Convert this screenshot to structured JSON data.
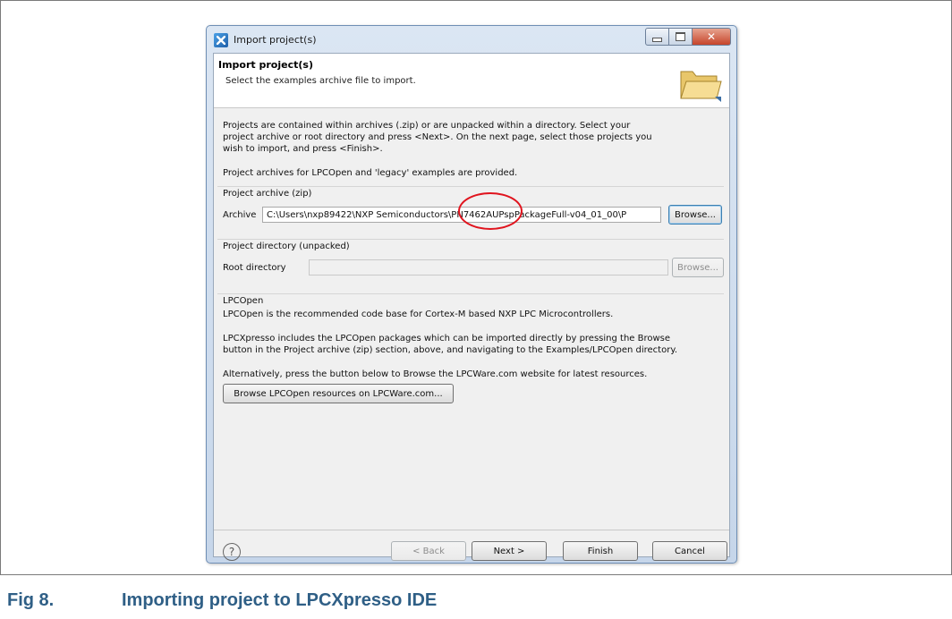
{
  "window": {
    "title": "Import project(s)"
  },
  "header": {
    "title": "Import project(s)",
    "description": "Select the examples archive file to import."
  },
  "intro": {
    "line1": "Projects are contained within archives (.zip) or are unpacked within a directory. Select your",
    "line2": "project archive or root directory and press <Next>. On the next page, select those projects you",
    "line3": "wish to import, and press <Finish>.",
    "line4": "Project archives for LPCOpen and 'legacy' examples are provided."
  },
  "archive_group": {
    "label": "Project archive (zip)",
    "field_label": "Archive",
    "value": "C:\\Users\\nxp89422\\NXP Semiconductors\\PN7462AUPspPackageFull-v04_01_00\\P",
    "browse_label": "Browse..."
  },
  "directory_group": {
    "label": "Project directory (unpacked)",
    "field_label": "Root directory",
    "value": "",
    "browse_label": "Browse..."
  },
  "lpcopen_group": {
    "label": "LPCOpen",
    "line1": "LPCOpen is the recommended code base for Cortex-M based NXP LPC Microcontrollers.",
    "line2": "LPCXpresso includes the LPCOpen packages which can be imported directly by pressing the Browse",
    "line3": "button in the Project archive (zip) section, above, and navigating to the Examples/LPCOpen directory.",
    "line4": "Alternatively, press the button below to Browse the LPCWare.com website for latest resources.",
    "button_label": "Browse LPCOpen resources on LPCWare.com..."
  },
  "footer": {
    "help_glyph": "?",
    "back_label": "< Back",
    "next_label": "Next >",
    "finish_label": "Finish",
    "cancel_label": "Cancel"
  },
  "caption": {
    "number": "Fig 8.",
    "text": "Importing project to LPCXpresso IDE"
  },
  "colors": {
    "caption": "#2f5f86",
    "highlight_ring": "#e0141e"
  }
}
